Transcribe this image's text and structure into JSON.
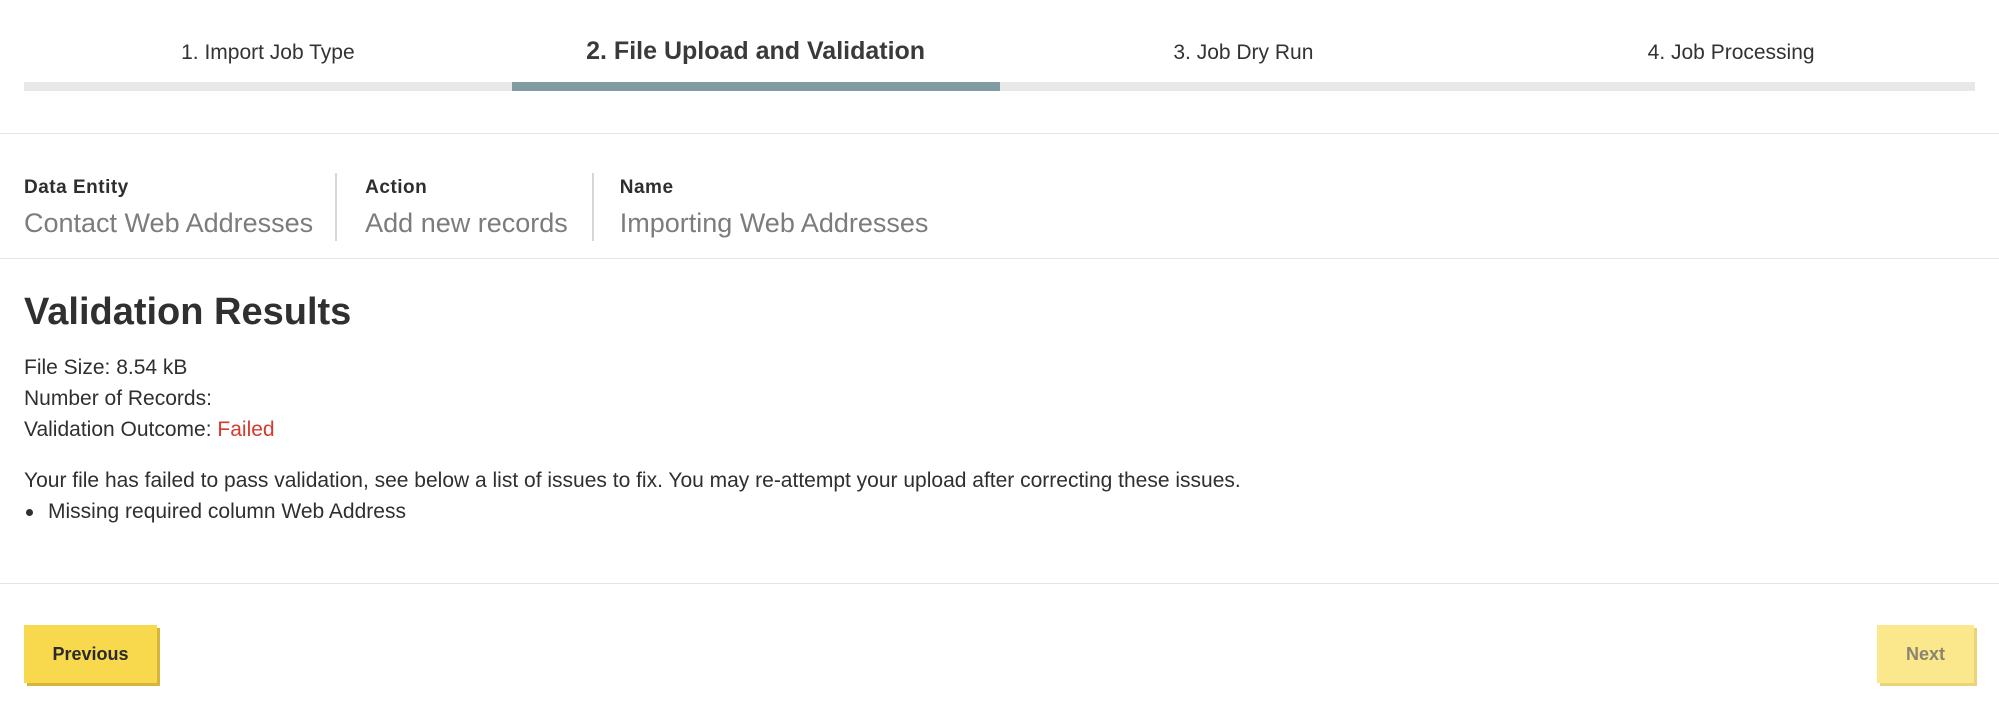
{
  "stepper": {
    "steps": [
      {
        "label": "1. Import Job Type"
      },
      {
        "label": "2. File Upload and Validation"
      },
      {
        "label": "3. Job Dry Run"
      },
      {
        "label": "4. Job Processing"
      }
    ],
    "active_step": 2
  },
  "summary": {
    "data_entity": {
      "label": "Data Entity",
      "value": "Contact Web Addresses"
    },
    "action": {
      "label": "Action",
      "value": "Add new records"
    },
    "name": {
      "label": "Name",
      "value": "Importing Web Addresses"
    }
  },
  "validation": {
    "title": "Validation Results",
    "file_size_label": "File Size:",
    "file_size_value": "8.54 kB",
    "records_label": "Number of Records:",
    "outcome_label": "Validation Outcome:",
    "outcome_value": "Failed",
    "message": "Your file has failed to pass validation, see below a list of issues to fix. You may re-attempt your upload after correcting these issues.",
    "issues": [
      "Missing required column Web Address"
    ]
  },
  "buttons": {
    "previous_label": "Previous",
    "next_label": "Next"
  },
  "colors": {
    "active_step_bar": "#819ca0",
    "inactive_step_bar": "#e8e8e8",
    "failed": "#d63a2c",
    "button_primary": "#f8d94e",
    "button_disabled": "#fbe88c"
  }
}
